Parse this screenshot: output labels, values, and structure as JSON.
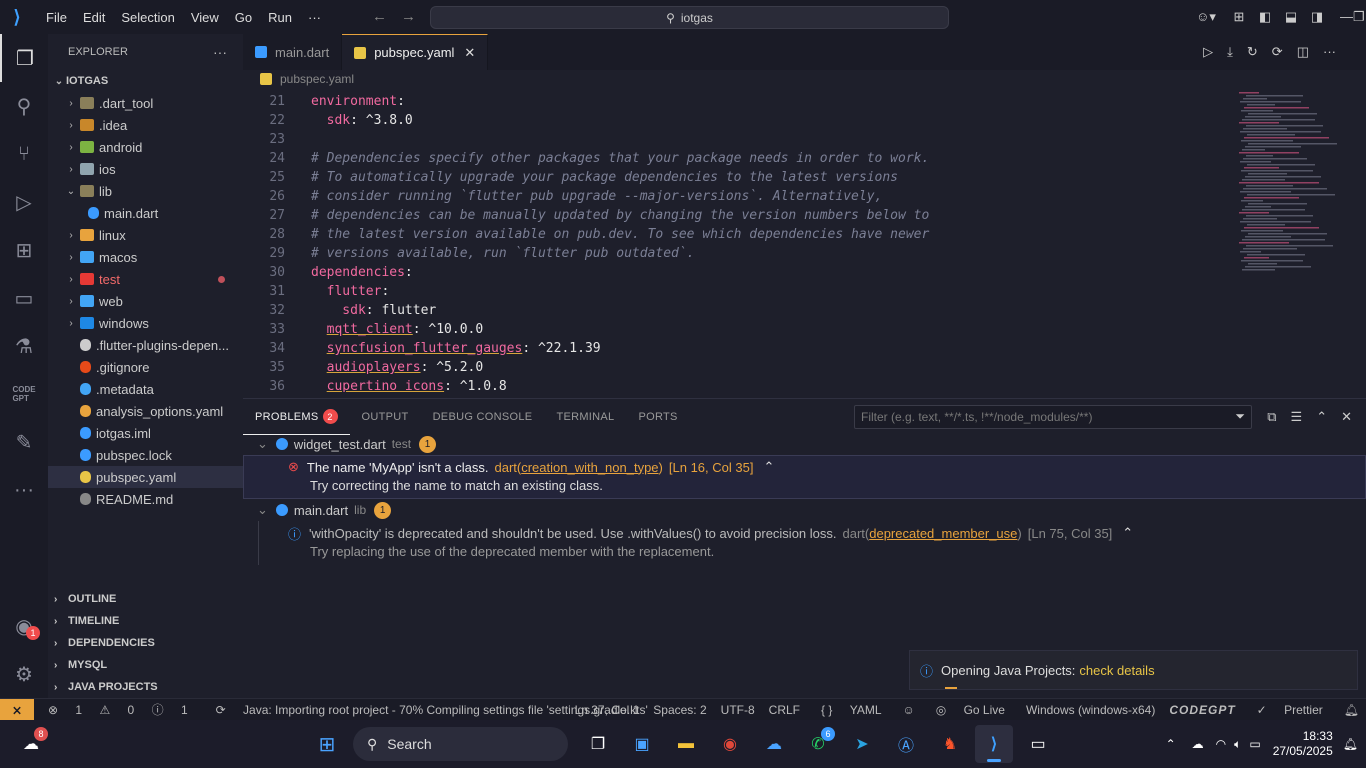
{
  "menu": [
    "File",
    "Edit",
    "Selection",
    "View",
    "Go",
    "Run",
    "···"
  ],
  "command_center": "iotgas",
  "explorer": {
    "title": "EXPLORER",
    "root": "IOTGAS",
    "items": [
      {
        "label": ".dart_tool",
        "type": "folder",
        "color": "#8a7f5a"
      },
      {
        "label": ".idea",
        "type": "folder",
        "color": "#c8872a"
      },
      {
        "label": "android",
        "type": "folder",
        "color": "#7cb342"
      },
      {
        "label": "ios",
        "type": "folder",
        "color": "#90a4ae"
      },
      {
        "label": "lib",
        "type": "folder-open",
        "color": "#8a7f5a"
      },
      {
        "label": "main.dart",
        "type": "file",
        "color": "#3b9bff"
      },
      {
        "label": "linux",
        "type": "folder",
        "color": "#e8a33d"
      },
      {
        "label": "macos",
        "type": "folder",
        "color": "#42a5f5"
      },
      {
        "label": "test",
        "type": "folder",
        "color": "#e53935",
        "status": "error"
      },
      {
        "label": "web",
        "type": "folder",
        "color": "#42a5f5"
      },
      {
        "label": "windows",
        "type": "folder",
        "color": "#1e88e5"
      },
      {
        "label": ".flutter-plugins-depen...",
        "type": "file",
        "color": "#cccccc"
      },
      {
        "label": ".gitignore",
        "type": "file",
        "color": "#e64a19"
      },
      {
        "label": ".metadata",
        "type": "file",
        "color": "#42a5f5"
      },
      {
        "label": "analysis_options.yaml",
        "type": "file",
        "color": "#e8a33d"
      },
      {
        "label": "iotgas.iml",
        "type": "file",
        "color": "#3b9bff"
      },
      {
        "label": "pubspec.lock",
        "type": "file",
        "color": "#3b9bff"
      },
      {
        "label": "pubspec.yaml",
        "type": "file",
        "color": "#e8c547",
        "selected": true
      },
      {
        "label": "README.md",
        "type": "file",
        "color": "#888888"
      }
    ],
    "sections": [
      "OUTLINE",
      "TIMELINE",
      "DEPENDENCIES",
      "MYSQL",
      "JAVA PROJECTS"
    ]
  },
  "tabs": [
    {
      "label": "main.dart",
      "active": false
    },
    {
      "label": "pubspec.yaml",
      "active": true
    }
  ],
  "breadcrumb": "pubspec.yaml",
  "code": [
    {
      "n": "21",
      "parts": [
        {
          "t": "environment",
          "c": "k"
        },
        {
          "t": ":",
          "c": "v"
        }
      ]
    },
    {
      "n": "22",
      "parts": [
        {
          "t": "  sdk",
          "c": "k"
        },
        {
          "t": ": ^3.8.0",
          "c": "v"
        }
      ]
    },
    {
      "n": "23",
      "parts": []
    },
    {
      "n": "24",
      "parts": [
        {
          "t": "# Dependencies specify other packages that your package needs in order to work.",
          "c": "c"
        }
      ]
    },
    {
      "n": "25",
      "parts": [
        {
          "t": "# To automatically upgrade your package dependencies to the latest versions",
          "c": "c"
        }
      ]
    },
    {
      "n": "26",
      "parts": [
        {
          "t": "# consider running `flutter pub upgrade --major-versions`. Alternatively,",
          "c": "c"
        }
      ]
    },
    {
      "n": "27",
      "parts": [
        {
          "t": "# dependencies can be manually updated by changing the version numbers below to",
          "c": "c"
        }
      ]
    },
    {
      "n": "28",
      "parts": [
        {
          "t": "# the latest version available on pub.dev. To see which dependencies have newer",
          "c": "c"
        }
      ]
    },
    {
      "n": "29",
      "parts": [
        {
          "t": "# versions available, run `flutter pub outdated`.",
          "c": "c"
        }
      ]
    },
    {
      "n": "30",
      "parts": [
        {
          "t": "dependencies",
          "c": "k"
        },
        {
          "t": ":",
          "c": "v"
        }
      ]
    },
    {
      "n": "31",
      "parts": [
        {
          "t": "  flutter",
          "c": "k"
        },
        {
          "t": ":",
          "c": "v"
        }
      ]
    },
    {
      "n": "32",
      "parts": [
        {
          "t": "    sdk",
          "c": "k"
        },
        {
          "t": ": flutter",
          "c": "v"
        }
      ]
    },
    {
      "n": "33",
      "parts": [
        {
          "t": "  ",
          "c": "v"
        },
        {
          "t": "mqtt_client",
          "c": "k u"
        },
        {
          "t": ": ^10.0.0",
          "c": "v"
        }
      ]
    },
    {
      "n": "34",
      "parts": [
        {
          "t": "  ",
          "c": "v"
        },
        {
          "t": "syncfusion_flutter_gauges",
          "c": "k u"
        },
        {
          "t": ": ^22.1.39",
          "c": "v"
        }
      ]
    },
    {
      "n": "35",
      "parts": [
        {
          "t": "  ",
          "c": "v"
        },
        {
          "t": "audioplayers",
          "c": "k u"
        },
        {
          "t": ": ^5.2.0",
          "c": "v"
        }
      ]
    },
    {
      "n": "36",
      "parts": [
        {
          "t": "  ",
          "c": "v"
        },
        {
          "t": "cupertino_icons",
          "c": "k u"
        },
        {
          "t": ": ^1.0.8",
          "c": "v"
        }
      ]
    }
  ],
  "panel": {
    "tabs": [
      "PROBLEMS",
      "OUTPUT",
      "DEBUG CONSOLE",
      "TERMINAL",
      "PORTS"
    ],
    "problems_count": "2",
    "filter_placeholder": "Filter (e.g. text, **/*.ts, !**/node_modules/**)",
    "groups": [
      {
        "file": "widget_test.dart",
        "folder": "test",
        "count": "1",
        "message": "The name 'MyApp' isn't a class.",
        "source": "dart(",
        "code": "creation_with_non_type",
        "source_end": ")",
        "location": "[Ln 16, Col 35]",
        "hint": "Try correcting the name to match an existing class."
      },
      {
        "file": "main.dart",
        "folder": "lib",
        "count": "1",
        "message": "'withOpacity' is deprecated and shouldn't be used. Use .withValues() to avoid precision loss.",
        "source": "dart(",
        "code": "deprecated_member_use",
        "source_end": ")",
        "location": "[Ln 75, Col 35]",
        "hint": "Try replacing the use of the deprecated member with the replacement."
      }
    ]
  },
  "toast": {
    "text": "Opening Java Projects:",
    "link": "check details"
  },
  "status": {
    "errors": "1",
    "warnings": "0",
    "infos": "1",
    "java": "Java: Importing root project - 70% Compiling settings file 'settings.gradle.kts'",
    "position": "Ln 37, Col 1",
    "spaces": "Spaces: 2",
    "encoding": "UTF-8",
    "eol": "CRLF",
    "language": "YAML",
    "golive": "Go Live",
    "platform": "Windows (windows-x64)",
    "codegpt": "CODEGPT",
    "prettier": "Prettier"
  },
  "taskbar": {
    "weather_badge": "8",
    "search": "Search",
    "whatsapp_badge": "6",
    "time": "18:33",
    "date": "27/05/2025"
  },
  "accounts_badge": "1"
}
